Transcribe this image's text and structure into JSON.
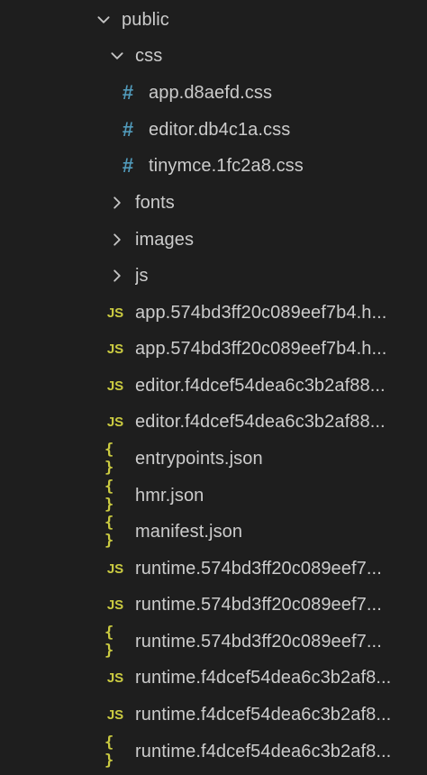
{
  "tree": {
    "public": {
      "label": "public",
      "icon": "chevron-down-icon",
      "expanded": true
    },
    "css": {
      "label": "css",
      "icon": "chevron-down-icon",
      "expanded": true
    },
    "css_files": [
      {
        "label": "app.d8aefd.css",
        "icon": "css-hash-icon",
        "icon_glyph": "#"
      },
      {
        "label": "editor.db4c1a.css",
        "icon": "css-hash-icon",
        "icon_glyph": "#"
      },
      {
        "label": "tinymce.1fc2a8.css",
        "icon": "css-hash-icon",
        "icon_glyph": "#"
      }
    ],
    "folders": [
      {
        "label": "fonts",
        "icon": "chevron-right-icon",
        "expanded": false
      },
      {
        "label": "images",
        "icon": "chevron-right-icon",
        "expanded": false
      },
      {
        "label": "js",
        "icon": "chevron-right-icon",
        "expanded": false
      }
    ],
    "files": [
      {
        "label": "app.574bd3ff20c089eef7b4.h...",
        "icon": "js-icon",
        "icon_glyph": "JS"
      },
      {
        "label": "app.574bd3ff20c089eef7b4.h...",
        "icon": "js-icon",
        "icon_glyph": "JS"
      },
      {
        "label": "editor.f4dcef54dea6c3b2af88...",
        "icon": "js-icon",
        "icon_glyph": "JS"
      },
      {
        "label": "editor.f4dcef54dea6c3b2af88...",
        "icon": "js-icon",
        "icon_glyph": "JS"
      },
      {
        "label": "entrypoints.json",
        "icon": "json-braces-icon",
        "icon_glyph": "{ }"
      },
      {
        "label": "hmr.json",
        "icon": "json-braces-icon",
        "icon_glyph": "{ }"
      },
      {
        "label": "manifest.json",
        "icon": "json-braces-icon",
        "icon_glyph": "{ }"
      },
      {
        "label": "runtime.574bd3ff20c089eef7...",
        "icon": "js-icon",
        "icon_glyph": "JS"
      },
      {
        "label": "runtime.574bd3ff20c089eef7...",
        "icon": "js-icon",
        "icon_glyph": "JS"
      },
      {
        "label": "runtime.574bd3ff20c089eef7...",
        "icon": "json-braces-icon",
        "icon_glyph": "{ }"
      },
      {
        "label": "runtime.f4dcef54dea6c3b2af8...",
        "icon": "js-icon",
        "icon_glyph": "JS"
      },
      {
        "label": "runtime.f4dcef54dea6c3b2af8...",
        "icon": "js-icon",
        "icon_glyph": "JS"
      },
      {
        "label": "runtime.f4dcef54dea6c3b2af8...",
        "icon": "json-braces-icon",
        "icon_glyph": "{ }"
      }
    ]
  },
  "colors": {
    "background": "#1e1e1e",
    "text": "#cccccc",
    "css_icon": "#519aba",
    "js_icon": "#cbcb41",
    "json_icon": "#cbcb41",
    "chevron": "#c5c5c5"
  }
}
